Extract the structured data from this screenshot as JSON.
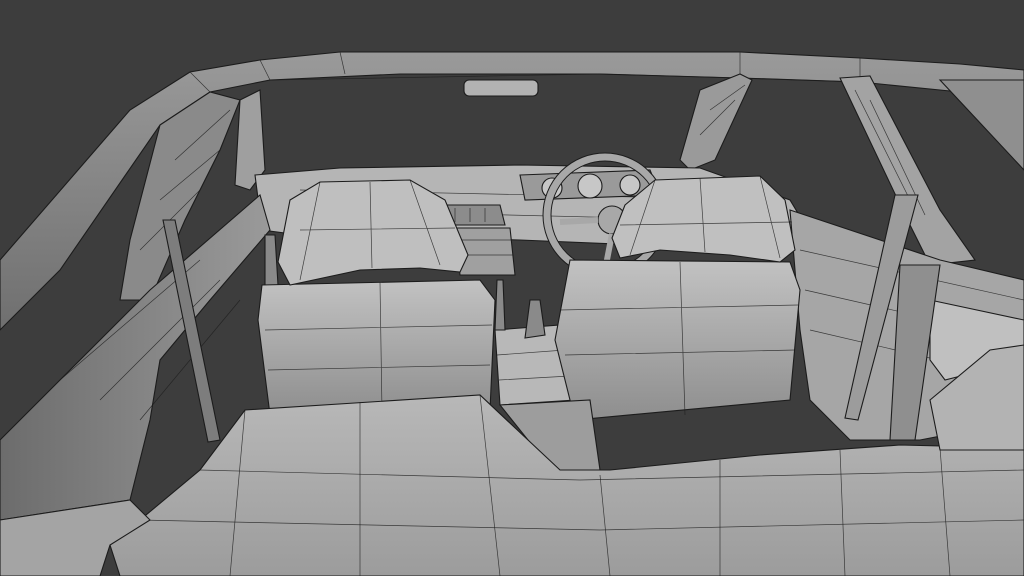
{
  "scene": {
    "description_icon": "car-interior-wireframe-render",
    "colors": {
      "background": "#3d3d3d",
      "surface": "#a9a9a9",
      "surface_light": "#bdbdbd",
      "surface_dark": "#7e7e7e",
      "wire": "#1e1e1e"
    }
  }
}
